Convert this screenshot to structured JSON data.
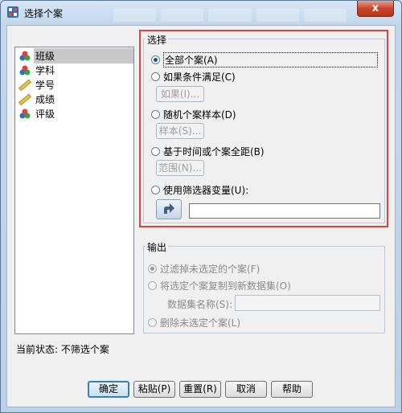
{
  "window": {
    "title": "选择个案",
    "close_glyph": "x"
  },
  "variables": [
    {
      "label": "班级",
      "icon": "nominal-variable-icon",
      "selected": true
    },
    {
      "label": "学科",
      "icon": "nominal-variable-icon",
      "selected": false
    },
    {
      "label": "学号",
      "icon": "scale-variable-icon",
      "selected": false
    },
    {
      "label": "成绩",
      "icon": "scale-variable-icon",
      "selected": false
    },
    {
      "label": "评级",
      "icon": "nominal-variable-icon",
      "selected": false
    }
  ],
  "select_group": {
    "legend": "选择",
    "options": [
      {
        "label": "全部个案(A)",
        "checked": true
      },
      {
        "label": "如果条件满足(C)",
        "checked": false
      },
      {
        "label": "随机个案样本(D)",
        "checked": false
      },
      {
        "label": "基于时间或个案全距(B)",
        "checked": false
      },
      {
        "label": "使用筛选器变量(U):",
        "checked": false
      }
    ],
    "if_button": "如果(I)...",
    "sample_button": "样本(S)...",
    "range_button": "范围(N)...",
    "filter_value": ""
  },
  "output_group": {
    "legend": "输出",
    "options": [
      {
        "label": "过滤掉未选定的个案(F)",
        "checked": true
      },
      {
        "label": "将选定个案复制到新数据集(O)",
        "checked": false
      },
      {
        "label": "删除未选定个案(L)",
        "checked": false
      }
    ],
    "dataset_name_label": "数据集名称(S):",
    "dataset_name_value": ""
  },
  "status": "当前状态: 不筛选个案",
  "buttons": {
    "ok": "确定",
    "paste": "粘贴(P)",
    "reset": "重置(R)",
    "cancel": "取消",
    "help": "帮助"
  },
  "colors": {
    "highlight_border": "#e04040",
    "checked_radio": "#1b4f8a"
  }
}
